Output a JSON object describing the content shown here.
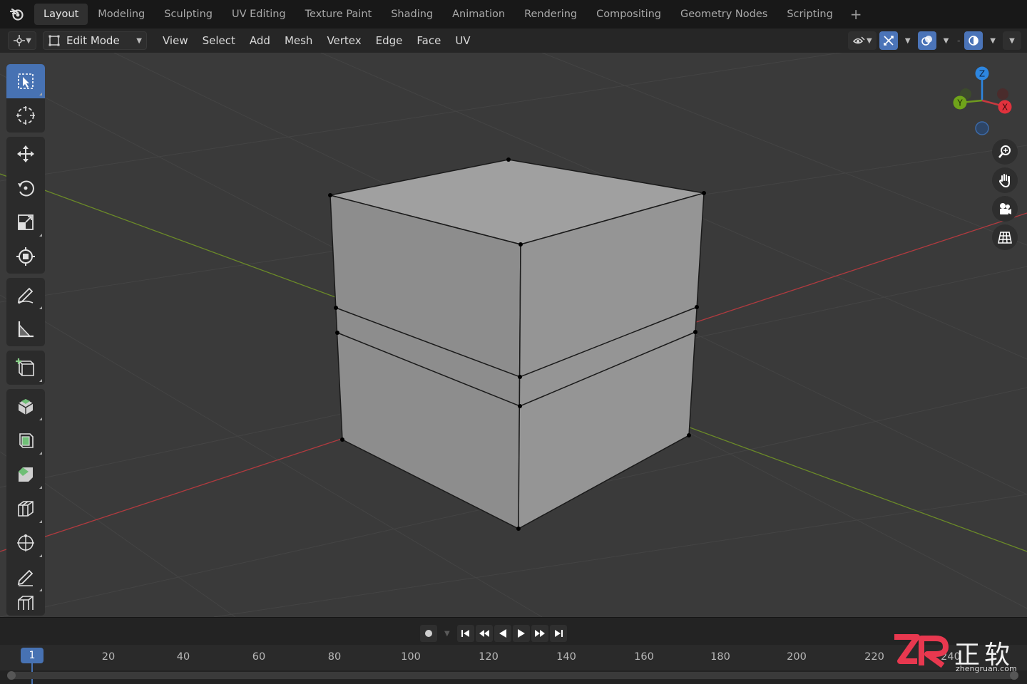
{
  "workspaces": {
    "tabs": [
      "Layout",
      "Modeling",
      "Sculpting",
      "UV Editing",
      "Texture Paint",
      "Shading",
      "Animation",
      "Rendering",
      "Compositing",
      "Geometry Nodes",
      "Scripting"
    ],
    "active": "Layout",
    "add_label": "+"
  },
  "header": {
    "mode": "Edit Mode",
    "menus": [
      "View",
      "Select",
      "Add",
      "Mesh",
      "Vertex",
      "Edge",
      "Face",
      "UV"
    ]
  },
  "toolbar": {
    "tools": [
      "select-box",
      "cursor",
      "move",
      "rotate",
      "scale",
      "transform",
      "annotate",
      "measure",
      "add-cube",
      "extrude",
      "inset",
      "bevel",
      "loop-cut",
      "knife",
      "poly-build",
      "spin"
    ]
  },
  "gizmo": {
    "x_label": "X",
    "y_label": "Y",
    "z_label": "Z"
  },
  "timeline": {
    "current_frame": "1",
    "ticks": [
      "20",
      "40",
      "60",
      "80",
      "100",
      "120",
      "140",
      "160",
      "180",
      "200",
      "220",
      "240"
    ]
  },
  "watermark": {
    "logo": "ZR",
    "chinese": "正软",
    "url": "zhengruan.com"
  },
  "colors": {
    "accent": "#4772b3",
    "viewport_bg": "#3a3a3a",
    "x_axis": "#c8393f",
    "y_axis": "#6f9a1f",
    "z_axis": "#2d86e0",
    "mesh_face": "#9a9a9a"
  }
}
